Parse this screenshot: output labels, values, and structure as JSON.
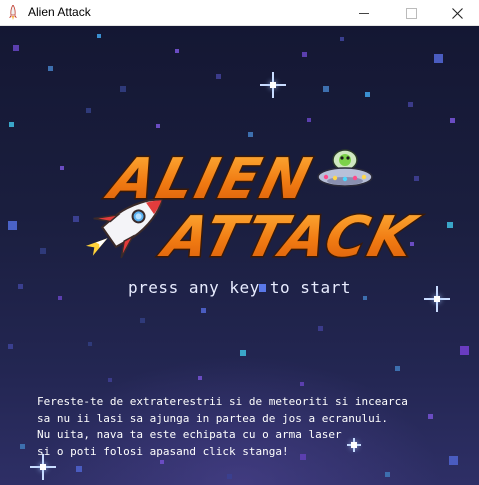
{
  "window": {
    "title": "Alien Attack",
    "app_icon": "rocket-icon",
    "controls": [
      "minimize",
      "maximize",
      "close"
    ]
  },
  "game": {
    "logo_line1": "ALIEN",
    "logo_line2": "ATTACK",
    "prompt": "press any key to start",
    "instructions": [
      "Fereste-te de extraterestrii si de meteoriti si incearca",
      "sa nu ii lasi sa ajunga in partea de jos a ecranului.",
      "Nu uita, nava ta este echipata cu o arma laser",
      "si o poti folosi apasand click stanga!"
    ]
  },
  "colors": {
    "background": "#1a1d3a",
    "logo_fill": "#f28a1a",
    "logo_outline": "#3a1a08",
    "text": "#ffffff"
  }
}
